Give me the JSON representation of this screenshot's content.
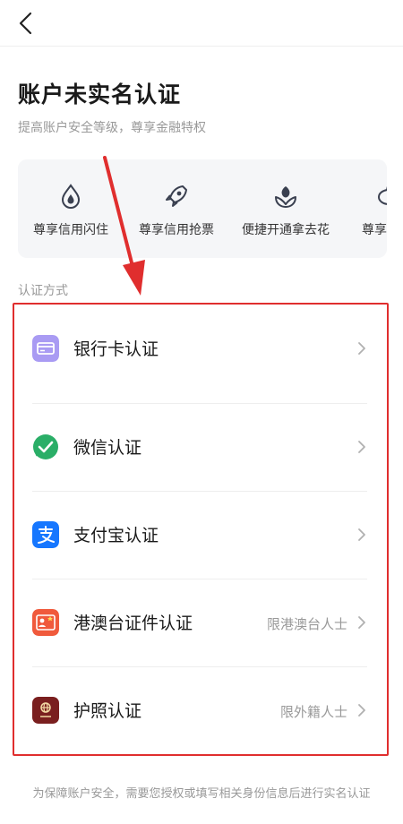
{
  "header": {
    "back_icon": "chevron-left-icon"
  },
  "page": {
    "title": "账户未实名认证",
    "subtitle": "提高账户安全等级，尊享金融特权"
  },
  "benefits": [
    {
      "icon": "water-drop-icon",
      "label": "尊享信用闪住"
    },
    {
      "icon": "rocket-icon",
      "label": "尊享信用抢票"
    },
    {
      "icon": "flower-icon",
      "label": "便捷开通拿去花"
    },
    {
      "icon": "piggy-bank-icon",
      "label": "尊享理"
    }
  ],
  "section_label": "认证方式",
  "methods": [
    {
      "icon": "bank-card-icon",
      "label": "银行卡认证",
      "note": "",
      "color": "#9b8cf0"
    },
    {
      "icon": "wechat-icon",
      "label": "微信认证",
      "note": "",
      "color": "#2aae67"
    },
    {
      "icon": "alipay-icon",
      "label": "支付宝认证",
      "note": "",
      "color": "#1677ff"
    },
    {
      "icon": "hk-macau-taiwan-permit-icon",
      "label": "港澳台证件认证",
      "note": "限港澳台人士",
      "color": "#f05a3c"
    },
    {
      "icon": "passport-icon",
      "label": "护照认证",
      "note": "限外籍人士",
      "color": "#7a1f1f"
    }
  ],
  "footer": {
    "text": "为保障账户安全，需要您授权或填写相关身份信息后进行实名认证"
  },
  "colors": {
    "highlight_border": "#e02e2e",
    "annotation_arrow": "#e02e2e"
  }
}
